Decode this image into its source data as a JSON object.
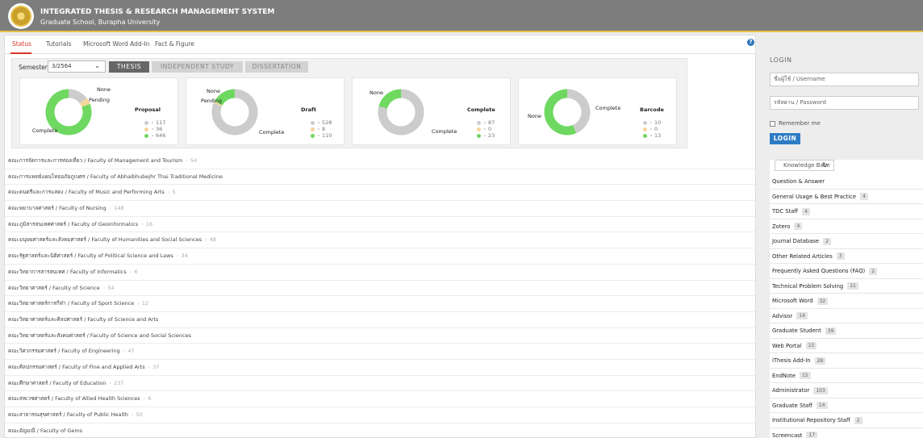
{
  "header": {
    "title": "INTEGRATED THESIS & RESEARCH MANAGEMENT SYSTEM",
    "subtitle": "Graduate School, Burapha University"
  },
  "tabs": [
    {
      "label": "Status"
    },
    {
      "label": "Tutorials"
    },
    {
      "label": "Microsoft Word Add-In"
    },
    {
      "label": "Fact & Figure"
    }
  ],
  "semester": {
    "label": "Semester",
    "value": "3/2564"
  },
  "types": [
    {
      "label": "THESIS"
    },
    {
      "label": "INDEPENDENT STUDY"
    },
    {
      "label": "DISSERTATION"
    }
  ],
  "colors": {
    "none": "#cccccc",
    "pending": "#f5d79a",
    "complete": "#6ed860"
  },
  "chart_data": [
    {
      "type": "pie",
      "title": "Proposal",
      "labels": [
        "None",
        "Pending",
        "Complete"
      ],
      "values": [
        117,
        36,
        646
      ]
    },
    {
      "type": "pie",
      "title": "Draft",
      "labels": [
        "None",
        "Pending",
        "Complete"
      ],
      "values": [
        528,
        8,
        110
      ]
    },
    {
      "type": "pie",
      "title": "Complete",
      "labels": [
        "None",
        "Pending",
        "Complete"
      ],
      "values": [
        87,
        0,
        23
      ]
    },
    {
      "type": "pie",
      "title": "Barcode",
      "labels": [
        "None",
        "Pending",
        "Complete"
      ],
      "values": [
        10,
        0,
        13
      ]
    }
  ],
  "faculties": [
    {
      "name": "คณะการจัดการและการท่องเที่ยว / Faculty of Management and Tourism",
      "count": "54"
    },
    {
      "name": "คณะการแพทย์แผนไทยอภัยภูเบศร / Faculty of Abhaibhubejhr Thai Traditional Medicine",
      "count": ""
    },
    {
      "name": "คณะดนตรีและการแสดง / Faculty of Music and Performing Arts",
      "count": "5"
    },
    {
      "name": "คณะพยาบาลศาสตร์ / Faculty of Nursing",
      "count": "148"
    },
    {
      "name": "คณะภูมิสารสนเทศศาสตร์ / Faculty of Geoinformatics",
      "count": "16"
    },
    {
      "name": "คณะมนุษยศาสตร์และสังคมศาสตร์ / Faculty of Humanities and Social Sciences",
      "count": "48"
    },
    {
      "name": "คณะรัฐศาสตร์และนิติศาสตร์ / Faculty of Political Science and Laws",
      "count": "34"
    },
    {
      "name": "คณะวิทยาการสารสนเทศ / Faculty of Informatics",
      "count": "6"
    },
    {
      "name": "คณะวิทยาศาสตร์ / Faculty of Science",
      "count": "54"
    },
    {
      "name": "คณะวิทยาศาสตร์การกีฬา / Faculty of Sport Science",
      "count": "12"
    },
    {
      "name": "คณะวิทยาศาสตร์และศิลปศาสตร์ / Faculty of Science and Arts",
      "count": ""
    },
    {
      "name": "คณะวิทยาศาสตร์และสังคมศาสตร์ / Faculty of Science and Social Sciences",
      "count": ""
    },
    {
      "name": "คณะวิศวกรรมศาสตร์ / Faculty of Engineering",
      "count": "47"
    },
    {
      "name": "คณะศิลปกรรมศาสตร์ / Faculty of Fine and Applied Arts",
      "count": "37"
    },
    {
      "name": "คณะศึกษาศาสตร์ / Faculty of Education",
      "count": "237"
    },
    {
      "name": "คณะสหเวชศาสตร์ / Faculty of Allied Health Sciences",
      "count": "6"
    },
    {
      "name": "คณะสาธารณสุขศาสตร์ / Faculty of Public Health",
      "count": "50"
    },
    {
      "name": "คณะอัญมณี / Faculty of Gems",
      "count": ""
    }
  ],
  "login": {
    "title": "LOGIN",
    "username_placeholder": "ชื่อผู้ใช้ / Username",
    "password_placeholder": "รหัสผ่าน / Password",
    "remember": "Remember me",
    "button": "LOGIN"
  },
  "kb": {
    "title": "Knowledge Base",
    "items": [
      {
        "label": "Question & Answer",
        "count": ""
      },
      {
        "label": "General Usage & Best Practice",
        "count": "4"
      },
      {
        "label": "TDC Staff",
        "count": "4"
      },
      {
        "label": "Zotero",
        "count": "4"
      },
      {
        "label": "Journal Database",
        "count": "2"
      },
      {
        "label": "Other Related Articles",
        "count": "3"
      },
      {
        "label": "Frequently Asked Questions (FAQ)",
        "count": "2"
      },
      {
        "label": "Technical Problem Solving",
        "count": "11"
      },
      {
        "label": "Microsoft Word",
        "count": "32"
      },
      {
        "label": "Advisor",
        "count": "14"
      },
      {
        "label": "Graduate Student",
        "count": "39"
      },
      {
        "label": "Web Portal",
        "count": "15"
      },
      {
        "label": "iThesis Add-In",
        "count": "28"
      },
      {
        "label": "EndNote",
        "count": "15"
      },
      {
        "label": "Administrator",
        "count": "103"
      },
      {
        "label": "Graduate Staff",
        "count": "14"
      },
      {
        "label": "Institutional Repository Staff",
        "count": "2"
      },
      {
        "label": "Screencast",
        "count": "17"
      }
    ]
  }
}
